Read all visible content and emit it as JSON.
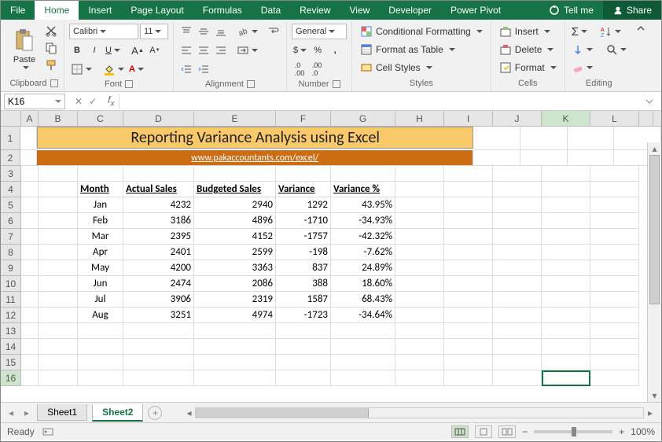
{
  "tabs": {
    "file": "File",
    "home": "Home",
    "insert": "Insert",
    "page_layout": "Page Layout",
    "formulas": "Formulas",
    "data": "Data",
    "review": "Review",
    "view": "View",
    "developer": "Developer",
    "power_pivot": "Power Pivot",
    "tell_me": "Tell me",
    "share": "Share"
  },
  "ribbon": {
    "clipboard": {
      "label": "Clipboard",
      "paste": "Paste"
    },
    "font": {
      "label": "Font",
      "name": "Calibri",
      "size": "11"
    },
    "alignment": {
      "label": "Alignment"
    },
    "number": {
      "label": "Number",
      "format": "General"
    },
    "styles": {
      "label": "Styles",
      "conditional": "Conditional Formatting",
      "table": "Format as Table",
      "cell": "Cell Styles"
    },
    "cells": {
      "label": "Cells",
      "insert": "Insert",
      "delete": "Delete",
      "format": "Format"
    },
    "editing": {
      "label": "Editing"
    }
  },
  "name_box": "K16",
  "cols": [
    "A",
    "B",
    "C",
    "D",
    "E",
    "F",
    "G",
    "H",
    "I",
    "J",
    "K",
    "L"
  ],
  "title_row": "Reporting Variance Analysis using Excel",
  "link_row": "www.pakaccountants.com/excel/",
  "headers": {
    "month": "Month",
    "actual": "Actual Sales",
    "budget": "Budgeted Sales",
    "variance": "Variance",
    "varpct": "Variance %"
  },
  "rows": [
    {
      "n": "5",
      "m": "Jan",
      "a": "4232",
      "b": "2940",
      "v": "1292",
      "p": "43.95%"
    },
    {
      "n": "6",
      "m": "Feb",
      "a": "3186",
      "b": "4896",
      "v": "-1710",
      "p": "-34.93%"
    },
    {
      "n": "7",
      "m": "Mar",
      "a": "2395",
      "b": "4152",
      "v": "-1757",
      "p": "-42.32%"
    },
    {
      "n": "8",
      "m": "Apr",
      "a": "2401",
      "b": "2599",
      "v": "-198",
      "p": "-7.62%"
    },
    {
      "n": "9",
      "m": "May",
      "a": "4200",
      "b": "3363",
      "v": "837",
      "p": "24.89%"
    },
    {
      "n": "10",
      "m": "Jun",
      "a": "2474",
      "b": "2086",
      "v": "388",
      "p": "18.60%"
    },
    {
      "n": "11",
      "m": "Jul",
      "a": "3906",
      "b": "2319",
      "v": "1587",
      "p": "68.43%"
    },
    {
      "n": "12",
      "m": "Aug",
      "a": "3251",
      "b": "4974",
      "v": "-1723",
      "p": "-34.64%"
    }
  ],
  "empty_rows": [
    "13",
    "14",
    "15",
    "16"
  ],
  "sheets": {
    "s1": "Sheet1",
    "s2": "Sheet2"
  },
  "status": {
    "ready": "Ready",
    "zoom": "100%"
  }
}
